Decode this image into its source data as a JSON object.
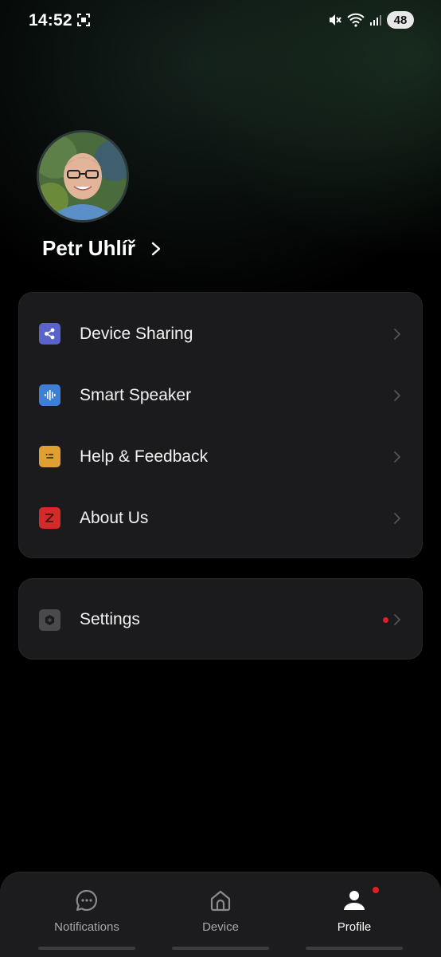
{
  "status_bar": {
    "time": "14:52",
    "battery": "48"
  },
  "profile": {
    "name": "Petr Uhlíř"
  },
  "menu": {
    "items": [
      {
        "label": "Device Sharing",
        "icon": "share-icon",
        "color": "#5a63c9"
      },
      {
        "label": "Smart Speaker",
        "icon": "soundwave-icon",
        "color": "#3d7fd6"
      },
      {
        "label": "Help & Feedback",
        "icon": "feedback-icon",
        "color": "#e0a030"
      },
      {
        "label": "About Us",
        "icon": "brand-logo-icon",
        "color": "#d42a2a"
      }
    ]
  },
  "settings": {
    "label": "Settings",
    "icon": "gear-icon",
    "has_notification": true
  },
  "bottom_nav": {
    "tabs": [
      {
        "label": "Notifications",
        "icon": "chat-bubble-icon",
        "active": false
      },
      {
        "label": "Device",
        "icon": "home-icon",
        "active": false
      },
      {
        "label": "Profile",
        "icon": "person-icon",
        "active": true,
        "badge": true
      }
    ]
  },
  "colors": {
    "background": "#000000",
    "card": "#1b1b1d",
    "accent_red": "#e41e26"
  }
}
